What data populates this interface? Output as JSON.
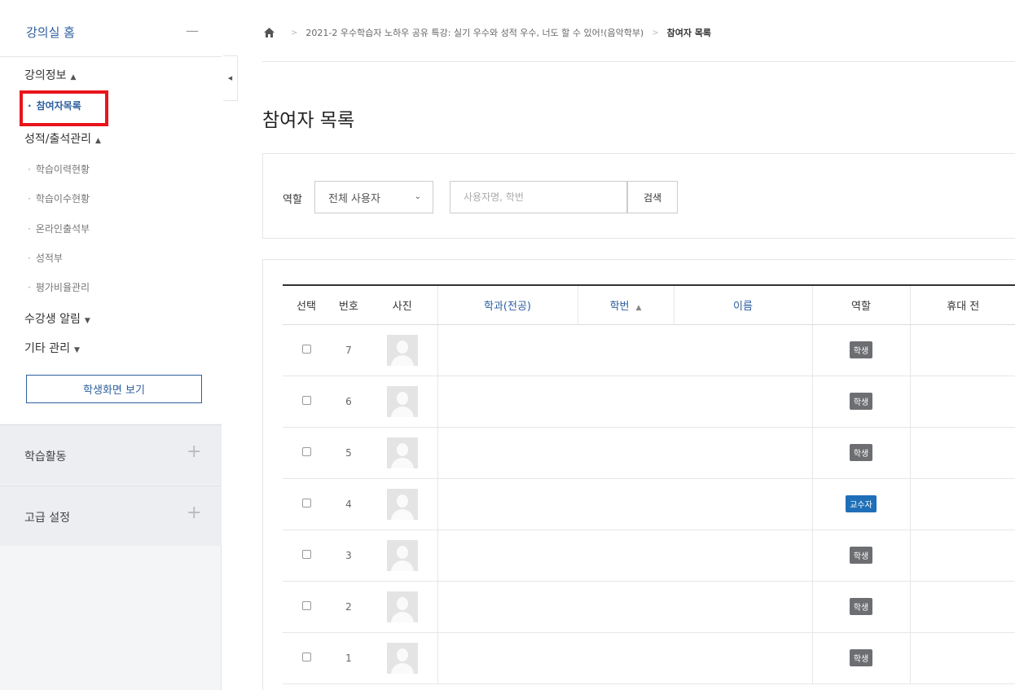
{
  "sidebar": {
    "home_label": "강의실 홈",
    "home_toggle": "—",
    "groups": [
      {
        "label": "강의정보",
        "caret": "▲"
      },
      {
        "label": "성적/출석관리",
        "caret": "▲"
      },
      {
        "label": "수강생 알림",
        "caret": "▼"
      },
      {
        "label": "기타 관리",
        "caret": "▼"
      }
    ],
    "items": [
      {
        "label": "참여자목록"
      },
      {
        "label": "학습이력현황"
      },
      {
        "label": "학습이수현황"
      },
      {
        "label": "온라인출석부"
      },
      {
        "label": "성적부"
      },
      {
        "label": "평가비율관리"
      }
    ],
    "student_view_button": "학생화면 보기",
    "sections": [
      {
        "label": "학습활동",
        "icon": "+"
      },
      {
        "label": "고급 설정",
        "icon": "+"
      }
    ],
    "collapse_icon": "◀"
  },
  "breadcrumb": {
    "course": "2021-2 우수학습자 노하우 공유 특강: 실기 우수와 성적 우수, 너도 할 수 있어!(음악학부)",
    "current": "참여자 목록",
    "separator": ">"
  },
  "page_title": "참여자 목록",
  "filter": {
    "role_label": "역할",
    "role_selected": "전체 사용자",
    "search_placeholder": "사용자명, 학번",
    "search_button": "검색"
  },
  "table": {
    "headers": [
      "선택",
      "번호",
      "사진",
      "학과(전공)",
      "학번",
      "이름",
      "역할",
      "휴대 전"
    ],
    "sort_caret": "▲",
    "rows": [
      {
        "no": "7",
        "role": "학생"
      },
      {
        "no": "6",
        "role": "학생"
      },
      {
        "no": "5",
        "role": "학생"
      },
      {
        "no": "4",
        "role": "교수자"
      },
      {
        "no": "3",
        "role": "학생"
      },
      {
        "no": "2",
        "role": "학생"
      },
      {
        "no": "1",
        "role": "학생"
      }
    ]
  },
  "colors": {
    "accent": "#2d5f9e",
    "highlight": "#e8141c",
    "student_badge": "#6d6e71",
    "professor_badge": "#1f6fb8"
  }
}
